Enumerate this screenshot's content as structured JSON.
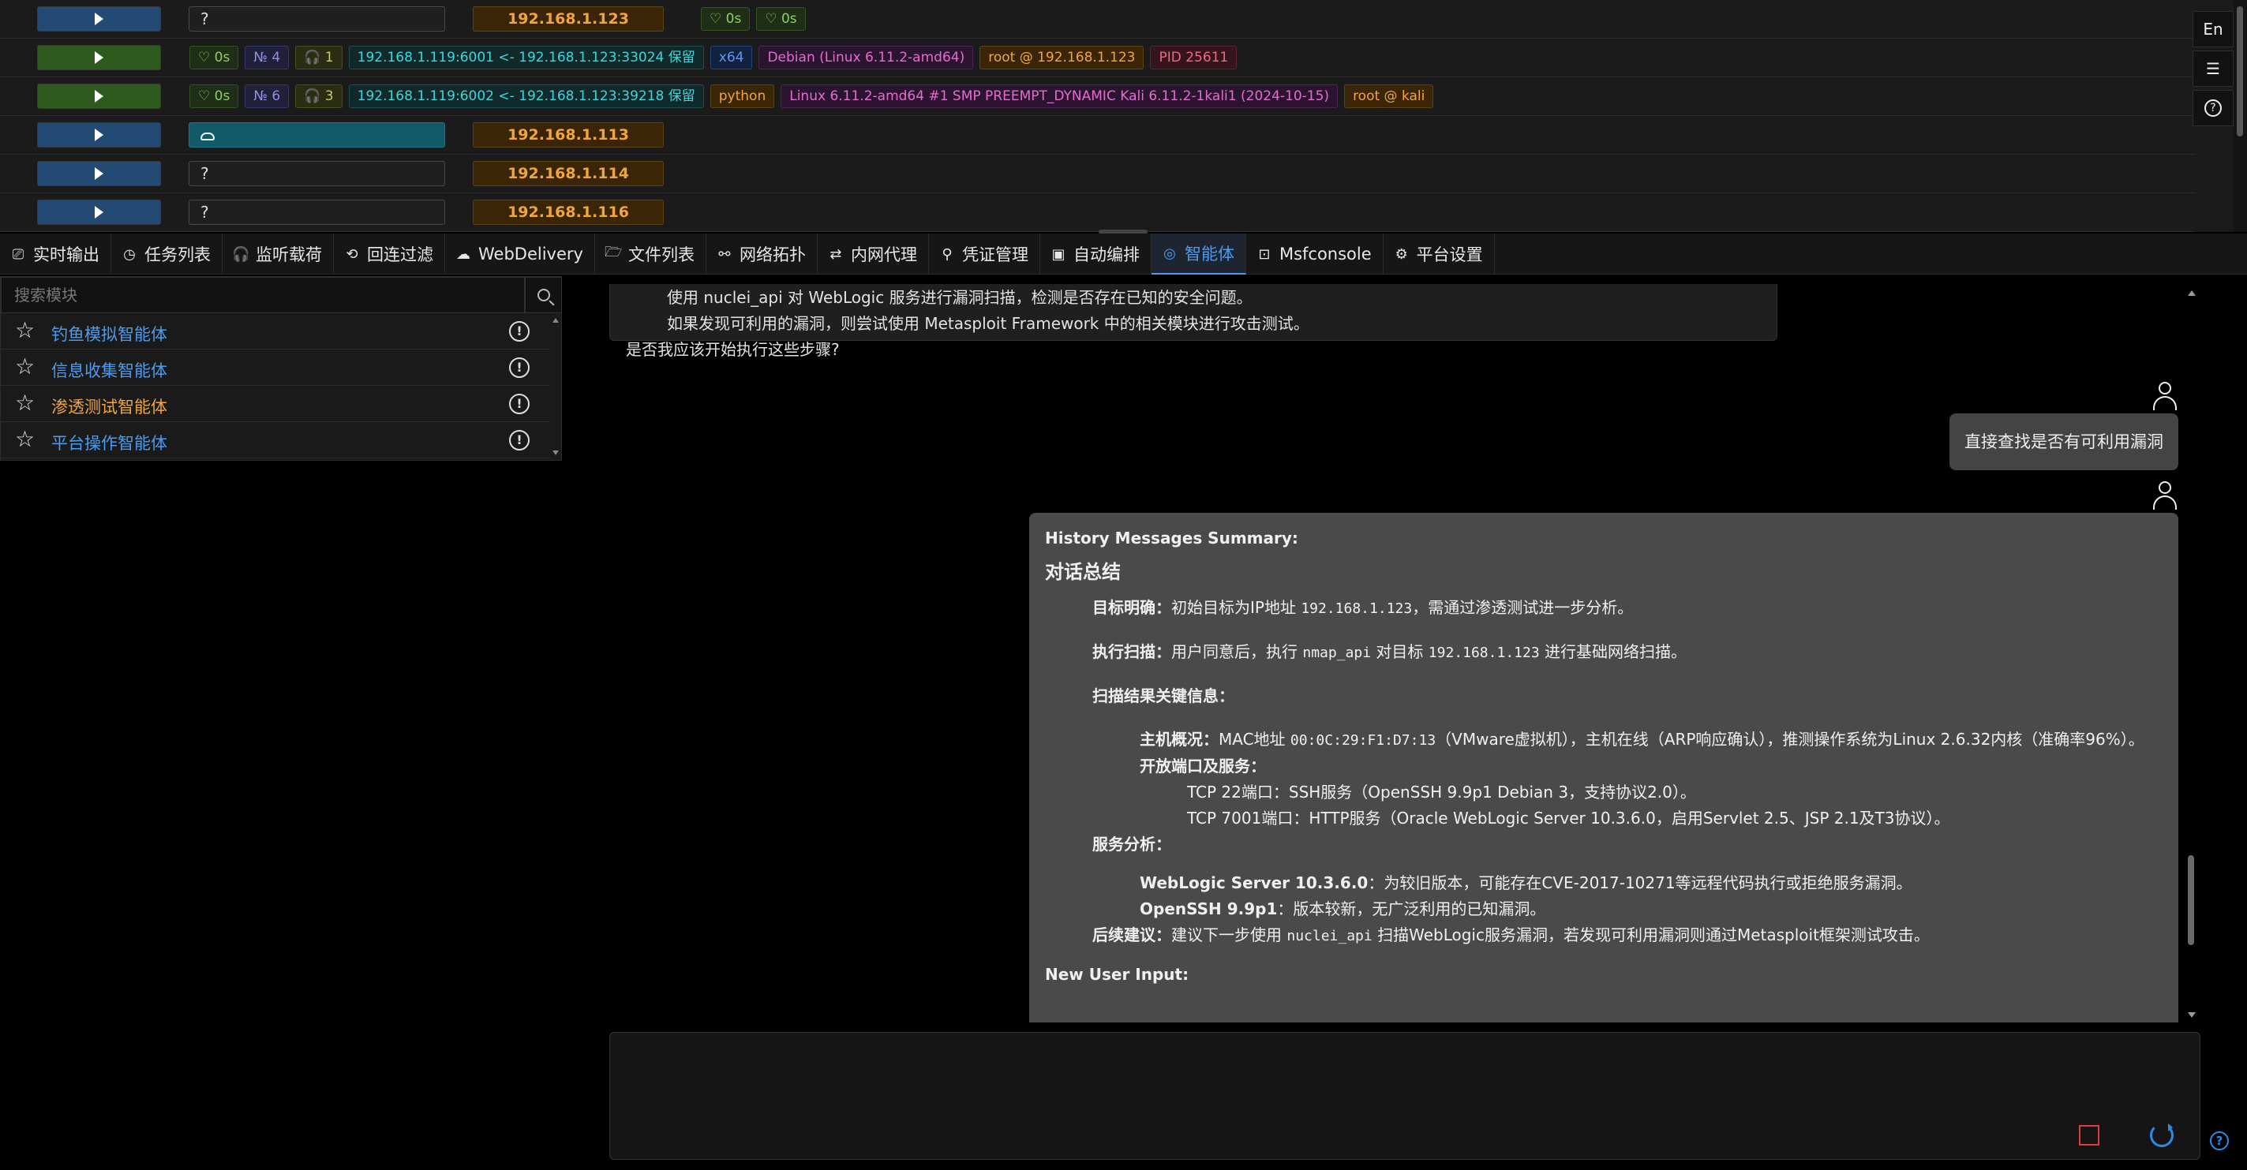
{
  "sessions": [
    {
      "play": "blue",
      "box": "?",
      "ip": "192.168.1.123",
      "tags": [
        {
          "t": "heart",
          "v": "♡ 0s"
        },
        {
          "t": "heart",
          "v": "♡ 0s"
        }
      ]
    },
    {
      "play": "green",
      "tags": [
        {
          "t": "heart",
          "v": "♡ 0s"
        },
        {
          "t": "num",
          "v": "№ 4"
        },
        {
          "t": "head",
          "v": "🎧 1"
        },
        {
          "t": "wifi",
          "v": "192.168.1.119:6001 <- 192.168.1.123:33024 保留"
        },
        {
          "t": "arch",
          "v": "x64"
        },
        {
          "t": "os",
          "v": "Debian (Linux 6.11.2-amd64)"
        },
        {
          "t": "user",
          "v": "root @ 192.168.1.123"
        },
        {
          "t": "pid",
          "v": "PID 25611"
        }
      ]
    },
    {
      "play": "green",
      "tags": [
        {
          "t": "heart",
          "v": "♡ 0s"
        },
        {
          "t": "num",
          "v": "№ 6"
        },
        {
          "t": "head",
          "v": "🎧 3"
        },
        {
          "t": "wifi",
          "v": "192.168.1.119:6002 <- 192.168.1.123:39218 保留"
        },
        {
          "t": "py",
          "v": "python"
        },
        {
          "t": "os",
          "v": "Linux 6.11.2-amd64 #1 SMP PREEMPT_DYNAMIC Kali 6.11.2-1kali1 (2024-10-15)"
        },
        {
          "t": "user",
          "v": "root @ kali"
        }
      ]
    },
    {
      "play": "blue",
      "box": "cloud",
      "ip": "192.168.1.113"
    },
    {
      "play": "blue",
      "box": "?",
      "ip": "192.168.1.114"
    },
    {
      "play": "blue",
      "box": "?",
      "ip": "192.168.1.116"
    }
  ],
  "sidetools": {
    "lang": "En"
  },
  "tabs": [
    {
      "icon": "⎚",
      "label": "实时输出"
    },
    {
      "icon": "◷",
      "label": "任务列表"
    },
    {
      "icon": "🎧",
      "label": "监听载荷"
    },
    {
      "icon": "⟲",
      "label": "回连过滤"
    },
    {
      "icon": "☁",
      "label": "WebDelivery"
    },
    {
      "icon": "🗁",
      "label": "文件列表"
    },
    {
      "icon": "⚯",
      "label": "网络拓扑"
    },
    {
      "icon": "⇄",
      "label": "内网代理"
    },
    {
      "icon": "⚲",
      "label": "凭证管理"
    },
    {
      "icon": "▣",
      "label": "自动编排"
    },
    {
      "icon": "◎",
      "label": "智能体",
      "active": true
    },
    {
      "icon": "⊡",
      "label": "Msfconsole"
    },
    {
      "icon": "⚙",
      "label": "平台设置"
    }
  ],
  "modules": {
    "search_placeholder": "搜索模块",
    "items": [
      {
        "label": "钓鱼模拟智能体",
        "color": "#4b9cf0"
      },
      {
        "label": "信息收集智能体",
        "color": "#4b9cf0"
      },
      {
        "label": "渗透测试智能体",
        "color": "#f1a53a"
      },
      {
        "label": "平台操作智能体",
        "color": "#4b9cf0"
      }
    ]
  },
  "chat": {
    "prev_lines": [
      "使用 nuclei_api 对 WebLogic 服务进行漏洞扫描，检测是否存在已知的安全问题。",
      "如果发现可利用的漏洞，则尝试使用 Metasploit Framework 中的相关模块进行攻击测试。",
      "是否我应该开始执行这些步骤?"
    ],
    "user_msg": "直接查找是否有可利用漏洞",
    "summary": {
      "header": "History Messages Summary:",
      "title": "对话总结",
      "goal_label": "目标明确：",
      "goal_text_a": "初始目标为IP地址 ",
      "goal_ip": "192.168.1.123",
      "goal_text_b": "，需通过渗透测试进一步分析。",
      "scan_label": "执行扫描：",
      "scan_text_a": "用户同意后，执行 ",
      "scan_api": "nmap_api",
      "scan_text_b": " 对目标 ",
      "scan_ip": "192.168.1.123",
      "scan_text_c": " 进行基础网络扫描。",
      "keyinfo_label": "扫描结果关键信息：",
      "host_label": "主机概况：",
      "host_text_a": "MAC地址 ",
      "host_mac": "00:0C:29:F1:D7:13",
      "host_text_b": "（VMware虚拟机），主机在线（ARP响应确认），推测操作系统为Linux 2.6.32内核（准确率96%）。",
      "ports_label": "开放端口及服务：",
      "port22": "TCP 22端口：SSH服务（OpenSSH 9.9p1 Debian 3，支持协议2.0）。",
      "port7001": "TCP 7001端口：HTTP服务（Oracle WebLogic Server 10.3.6.0，启用Servlet 2.5、JSP 2.1及T3协议）。",
      "svc_label": "服务分析：",
      "weblogic_label": "WebLogic Server 10.3.6.0",
      "weblogic_text": "：为较旧版本，可能存在CVE-2017-10271等远程代码执行或拒绝服务漏洞。",
      "openssh_label": "OpenSSH 9.9p1",
      "openssh_text": "：版本较新，无广泛利用的已知漏洞。",
      "next_label": "后续建议：",
      "next_text_a": "建议下一步使用 ",
      "next_api": "nuclei_api",
      "next_text_b": " 扫描WebLogic服务漏洞，若发现可利用漏洞则通过Metasploit框架测试攻击。",
      "new_input": "New User Input:"
    }
  },
  "input": {
    "value": ""
  }
}
